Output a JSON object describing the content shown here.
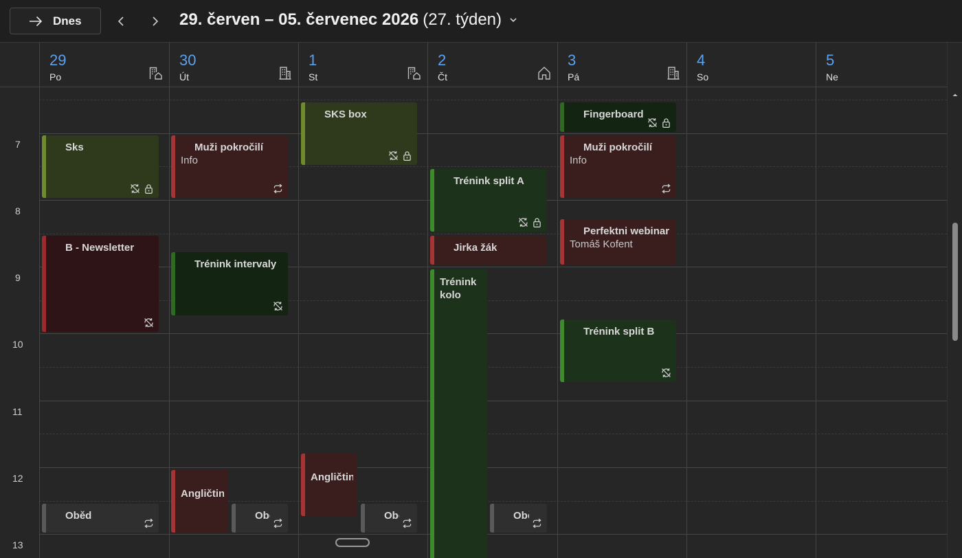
{
  "toolbar": {
    "today_label": "Dnes",
    "range_title": "29. červen – 05. červenec 2026",
    "week_label": "(27. týden)"
  },
  "days": [
    {
      "num": "29",
      "name": "Po",
      "icon": "building-home-icon"
    },
    {
      "num": "30",
      "name": "Út",
      "icon": "building-icon"
    },
    {
      "num": "1",
      "name": "St",
      "icon": "building-home-icon"
    },
    {
      "num": "2",
      "name": "Čt",
      "icon": "home-icon"
    },
    {
      "num": "3",
      "name": "Pá",
      "icon": "building-icon"
    },
    {
      "num": "4",
      "name": "So",
      "icon": ""
    },
    {
      "num": "5",
      "name": "Ne",
      "icon": ""
    }
  ],
  "hours": [
    "7",
    "8",
    "9",
    "10",
    "11",
    "12",
    "13"
  ],
  "events": {
    "sks": {
      "title": "Sks"
    },
    "muzi_ut": {
      "title": "Muži pokročilí",
      "sub": "Info"
    },
    "sks_box": {
      "title": "SKS box"
    },
    "fingerboard": {
      "title": "Fingerboard -"
    },
    "muzi_pa": {
      "title": "Muži pokročilí",
      "sub": "Info"
    },
    "trenink_split_a": {
      "title": "Trénink split A"
    },
    "b_newsletter": {
      "title": "B - Newsletter"
    },
    "perfektni_webinar": {
      "title": "Perfektni webinar",
      "sub": "Tomáš Kofent"
    },
    "trenink_intervaly": {
      "title": "Trénink intervaly"
    },
    "jirka_zak": {
      "title": "Jirka žák"
    },
    "trenink_kolo": {
      "title": "Trénink kolo"
    },
    "trenink_split_b": {
      "title": "Trénink split B"
    },
    "anglictina_ut": {
      "title": "Angličtina"
    },
    "anglictina_st": {
      "title": "Angličtina"
    },
    "obed_po": {
      "title": "Oběd"
    },
    "obed_ut": {
      "title": "Oběd"
    },
    "obed_st": {
      "title": "Oběd"
    },
    "obed_ct": {
      "title": "Oběd"
    }
  },
  "colors": {
    "accent": "#5aa2ef",
    "background": "#262626",
    "event_olive": "#2f3a1c",
    "event_red": "#3a1e1e",
    "event_green": "#1d321b"
  }
}
